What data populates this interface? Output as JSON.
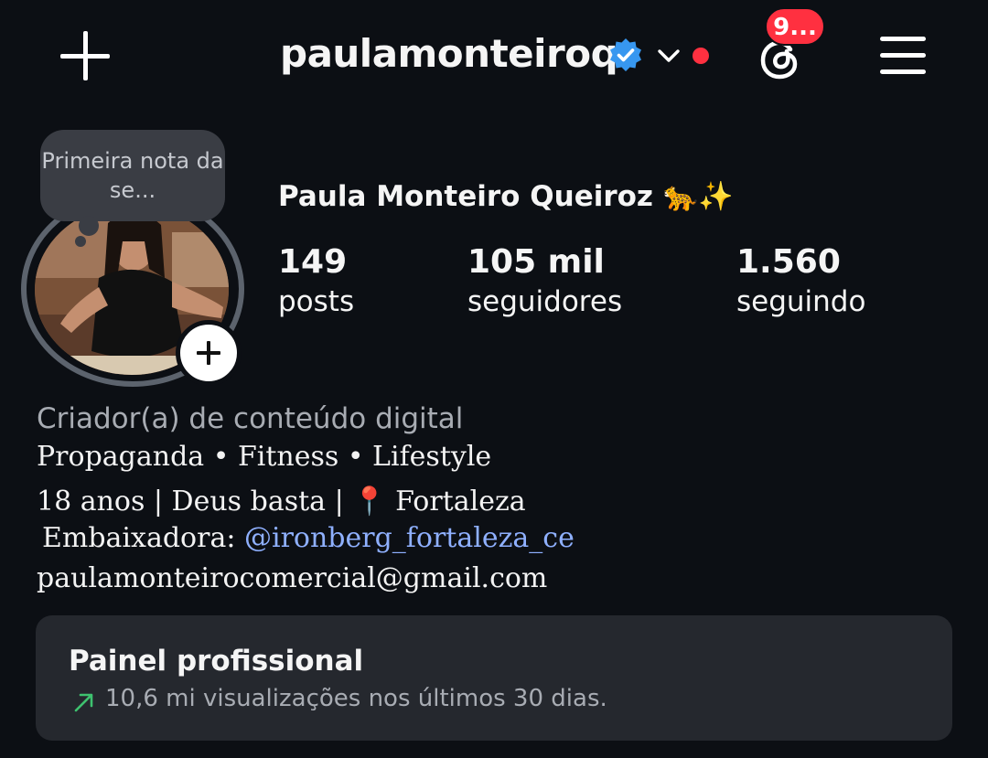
{
  "header": {
    "username": "paulamonteiroq",
    "notification_count": "9...",
    "icons": {
      "create": "plus-icon",
      "verified": "verified-badge-icon",
      "account_switcher": "chevron-down-icon",
      "threads": "threads-icon",
      "menu": "hamburger-menu-icon"
    }
  },
  "profile": {
    "note": "Primeira nota da se...",
    "full_name": "Paula Monteiro Queiroz 🐆✨",
    "stats": [
      {
        "value": "149",
        "label": "posts"
      },
      {
        "value": "105 mil",
        "label": "seguidores"
      },
      {
        "value": "1.560",
        "label": "seguindo"
      }
    ]
  },
  "bio": {
    "category": "Criador(a) de conteúdo digital",
    "line1": "Propaganda • Fitness • Lifestyle",
    "line2": "18 anos | Deus basta | 📍 Fortaleza",
    "line3_prefix": "Embaixadora: ",
    "line3_link": "@ironberg_fortaleza_ce",
    "line4": "paulamonteirocomercial@gmail.com"
  },
  "professional_panel": {
    "title": "Painel profissional",
    "subtitle": "10,6 mi visualizações nos últimos 30 dias."
  },
  "colors": {
    "background": "#0c0f14",
    "verified_blue": "#3797f0",
    "notification_red": "#ff3040",
    "link_blue": "#8fb0ff",
    "trend_green": "#3ec26f",
    "panel_bg": "#25282e"
  }
}
